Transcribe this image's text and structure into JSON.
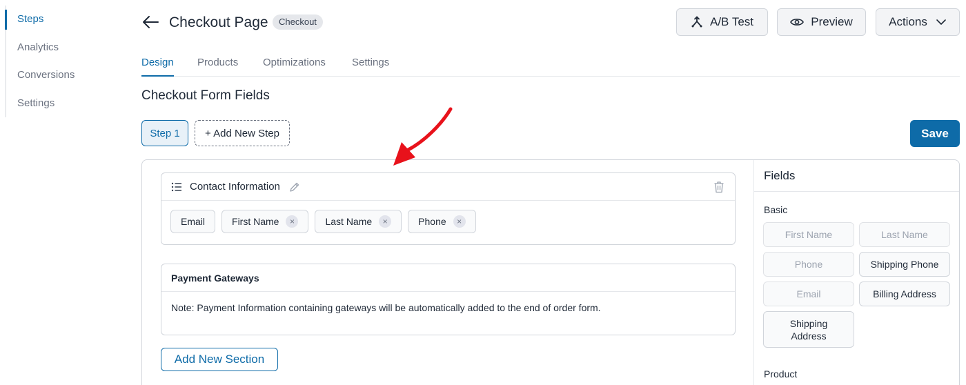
{
  "sidebar": {
    "items": [
      {
        "label": "Steps",
        "active": true
      },
      {
        "label": "Analytics"
      },
      {
        "label": "Conversions"
      },
      {
        "label": "Settings"
      }
    ]
  },
  "header": {
    "back_icon": "arrow-left-icon",
    "title": "Checkout Page",
    "badge": "Checkout",
    "ab_test_label": "A/B Test",
    "ab_test_icon": "split-arrows-icon",
    "preview_label": "Preview",
    "preview_icon": "eye-icon",
    "actions_label": "Actions",
    "actions_icon": "chevron-down-icon"
  },
  "tabs": [
    {
      "label": "Design",
      "active": true
    },
    {
      "label": "Products"
    },
    {
      "label": "Optimizations"
    },
    {
      "label": "Settings"
    }
  ],
  "section_title": "Checkout Form Fields",
  "steps": {
    "step1_label": "Step 1",
    "add_step_label": "+ Add New Step"
  },
  "save_label": "Save",
  "contact_section": {
    "title": "Contact Information",
    "fields": [
      {
        "label": "Email",
        "removable": false
      },
      {
        "label": "First Name",
        "removable": true
      },
      {
        "label": "Last Name",
        "removable": true
      },
      {
        "label": "Phone",
        "removable": true
      }
    ],
    "remove_glyph": "×"
  },
  "payment_section": {
    "title": "Payment Gateways",
    "note": "Note: Payment Information containing gateways will be automatically added to the end of order form."
  },
  "add_section_label": "Add New Section",
  "fields_panel": {
    "title": "Fields",
    "basic_label": "Basic",
    "basic_fields": [
      {
        "label": "First Name",
        "enabled": false
      },
      {
        "label": "Last Name",
        "enabled": false
      },
      {
        "label": "Phone",
        "enabled": false
      },
      {
        "label": "Shipping Phone",
        "enabled": true
      },
      {
        "label": "Email",
        "enabled": false
      },
      {
        "label": "Billing Address",
        "enabled": true
      },
      {
        "label": "Shipping Address",
        "enabled": true
      }
    ],
    "product_label": "Product"
  },
  "colors": {
    "accent": "#0e6ba8",
    "annotation_arrow": "#e8121b"
  }
}
